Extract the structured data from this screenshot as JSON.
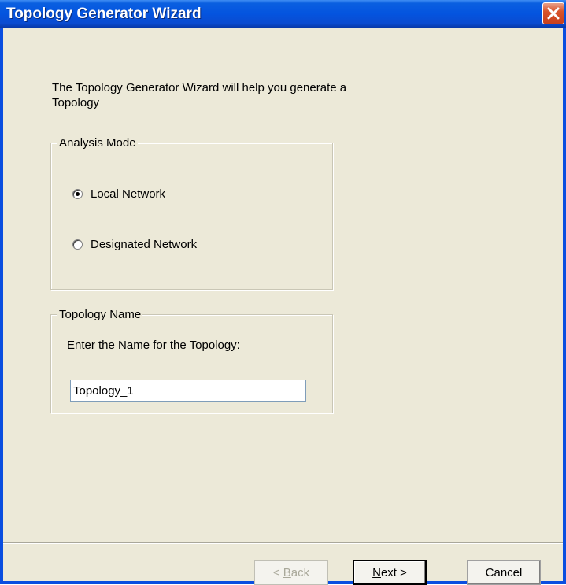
{
  "window": {
    "title": "Topology Generator Wizard"
  },
  "intro_text": "The Topology Generator Wizard will help you generate a Topology",
  "analysis_mode": {
    "label": "Analysis Mode",
    "options": [
      {
        "label": "Local Network",
        "selected": true
      },
      {
        "label": "Designated Network",
        "selected": false
      }
    ]
  },
  "topology_name": {
    "label": "Topology Name",
    "prompt": "Enter the Name for the Topology:",
    "value": "Topology_1"
  },
  "buttons": {
    "back": {
      "mnemonic": "B",
      "rest": "ack",
      "prefix": "< "
    },
    "next": {
      "mnemonic": "N",
      "rest": "ext >"
    },
    "cancel": "Cancel"
  }
}
